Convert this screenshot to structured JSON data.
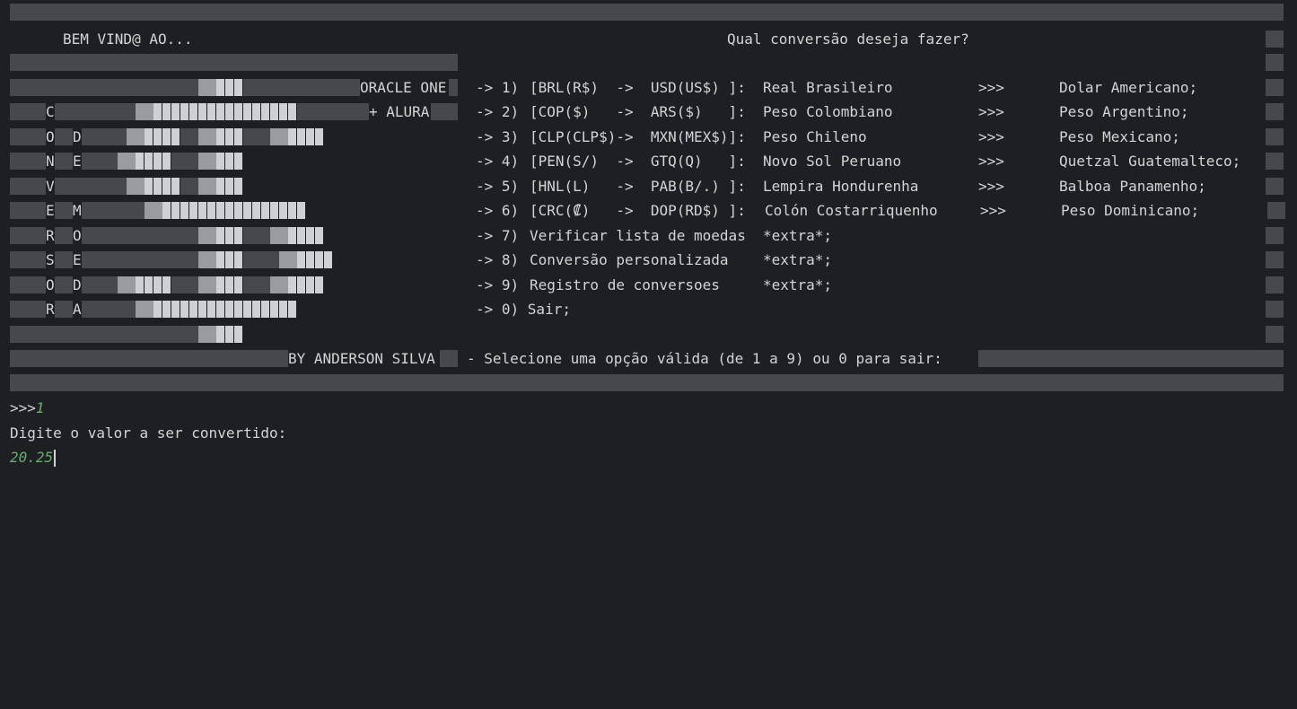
{
  "header": {
    "welcome": "BEM VIND@ AO...",
    "question": "Qual conversão deseja fazer?"
  },
  "logo": {
    "oracle": "ORACLE ONE",
    "plus_alura": "+ ALURA",
    "conversor": [
      "C",
      "O",
      "N",
      "V",
      "E",
      "R",
      "S",
      "O",
      "R"
    ],
    "moedas": [
      "D",
      "E",
      "M",
      "O",
      "E",
      "D",
      "A"
    ],
    "author": "BY ANDERSON SILVA"
  },
  "menu": {
    "options": [
      {
        "num": "-> 1)",
        "codes": "[BRL(R$)  ->  USD(US$) ]:",
        "from": "Real Brasileiro",
        "sep": ">>>",
        "to": "Dolar Americano;"
      },
      {
        "num": "-> 2)",
        "codes": "[COP($)   ->  ARS($)   ]:",
        "from": "Peso Colombiano",
        "sep": ">>>",
        "to": "Peso Argentino;"
      },
      {
        "num": "-> 3)",
        "codes": "[CLP(CLP$)->  MXN(MEX$)]:",
        "from": "Peso Chileno",
        "sep": ">>>",
        "to": "Peso Mexicano;"
      },
      {
        "num": "-> 4)",
        "codes": "[PEN(S/)  ->  GTQ(Q)   ]:",
        "from": "Novo Sol Peruano",
        "sep": ">>>",
        "to": "Quetzal Guatemalteco;"
      },
      {
        "num": "-> 5)",
        "codes": "[HNL(L)   ->  PAB(B/.) ]:",
        "from": "Lempira Hondurenha",
        "sep": ">>>",
        "to": "Balboa Panamenho;"
      },
      {
        "num": "-> 6)",
        "codes": "[CRC(₡)   ->  DOP(RD$) ]:",
        "from": "Colón Costarriquenho",
        "sep": ">>>",
        "to": "Peso Dominicano;"
      }
    ],
    "extras": [
      {
        "num": "-> 7)",
        "label": "Verificar lista de moedas",
        "tag": "*extra*;"
      },
      {
        "num": "-> 8)",
        "label": "Conversão personalizada",
        "tag": "*extra*;"
      },
      {
        "num": "-> 9)",
        "label": "Registro de conversoes",
        "tag": "*extra*;"
      }
    ],
    "exit": "-> 0) Sair;",
    "prompt": "- Selecione uma opção válida (de 1 a 9) ou 0 para sair:"
  },
  "console": {
    "prompt_symbol": ">>>",
    "choice": "1",
    "ask_value": "Digite o valor a ser convertido:",
    "value_input": "20.25"
  }
}
